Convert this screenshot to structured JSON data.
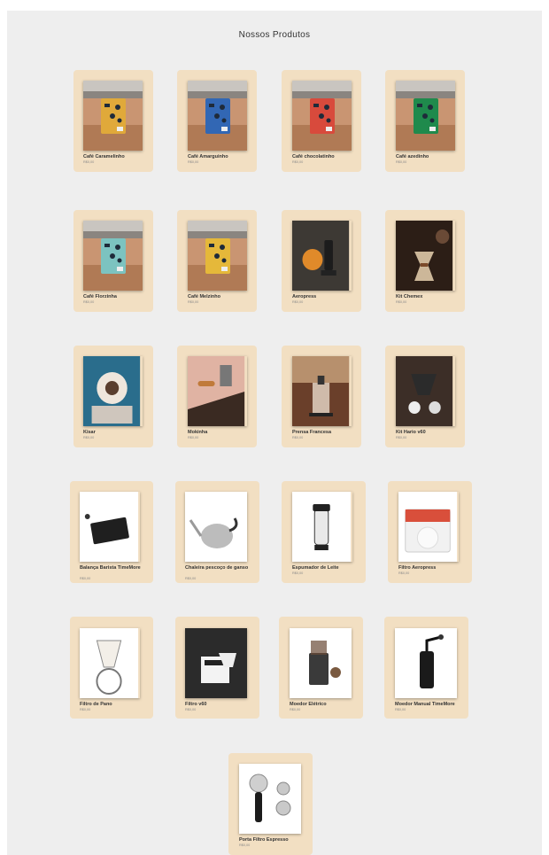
{
  "page": {
    "title": "Nossos Produtos"
  },
  "products": [
    {
      "name": "Café Caramelinho",
      "price": "R$0,00",
      "icon": "coffee-bag-icon",
      "color": "#e0a93a"
    },
    {
      "name": "Café Amarguinho",
      "price": "R$0,00",
      "icon": "coffee-bag-icon",
      "color": "#3267b4"
    },
    {
      "name": "Café chocolatinho",
      "price": "R$0,00",
      "icon": "coffee-bag-icon",
      "color": "#d84a3c"
    },
    {
      "name": "Café azedinho",
      "price": "R$0,00",
      "icon": "coffee-bag-icon",
      "color": "#1f8a4c"
    },
    {
      "name": "Café Florzinha",
      "price": "R$0,00",
      "icon": "coffee-bag-icon",
      "color": "#7cc3c0"
    },
    {
      "name": "Café Melzinho",
      "price": "R$0,00",
      "icon": "coffee-bag-icon",
      "color": "#e5b83a"
    },
    {
      "name": "Aeropress",
      "price": "R$0,00",
      "icon": "aeropress-icon",
      "color": "#3a3530"
    },
    {
      "name": "Kit Chemex",
      "price": "R$0,00",
      "icon": "chemex-icon",
      "color": "#3b2a20"
    },
    {
      "name": "Kisar",
      "price": "R$0,00",
      "icon": "grinder-photo-icon",
      "color": "#4a3b33"
    },
    {
      "name": "Mokinha",
      "price": "R$0,00",
      "icon": "moka-pot-icon",
      "color": "#d9a38f"
    },
    {
      "name": "Prensa Francesa",
      "price": "R$0,00",
      "icon": "french-press-icon",
      "color": "#5a3a2a"
    },
    {
      "name": "Kit Hario v60",
      "price": "R$0,00",
      "icon": "v60-kit-icon",
      "color": "#3c2e27"
    },
    {
      "name": "Balança Barista TimeMore",
      "price": "R$0,00",
      "icon": "scale-icon",
      "color": "#ffffff"
    },
    {
      "name": "Chaleira pescoço de ganso",
      "price": "R$0,00",
      "icon": "kettle-icon",
      "color": "#ffffff"
    },
    {
      "name": "Espumador de Leite",
      "price": "R$0,00",
      "icon": "milk-frother-icon",
      "color": "#ffffff"
    },
    {
      "name": "Filtro Aeropress",
      "price": "R$0,00",
      "icon": "aeropress-filter-icon",
      "color": "#ffffff"
    },
    {
      "name": "Filtro de Pano",
      "price": "R$0,00",
      "icon": "cloth-filter-icon",
      "color": "#ffffff"
    },
    {
      "name": "Filtro v60",
      "price": "R$0,00",
      "icon": "paper-filter-icon",
      "color": "#2b2b2b"
    },
    {
      "name": "Moedor Elétrico",
      "price": "R$0,00",
      "icon": "electric-grinder-icon",
      "color": "#ffffff"
    },
    {
      "name": "Moedor Manual TimeMore",
      "price": "R$0,00",
      "icon": "manual-grinder-icon",
      "color": "#ffffff"
    },
    {
      "name": "Porta Filtro Espresso",
      "price": "R$0,00",
      "icon": "portafilter-icon",
      "color": "#ffffff"
    }
  ]
}
